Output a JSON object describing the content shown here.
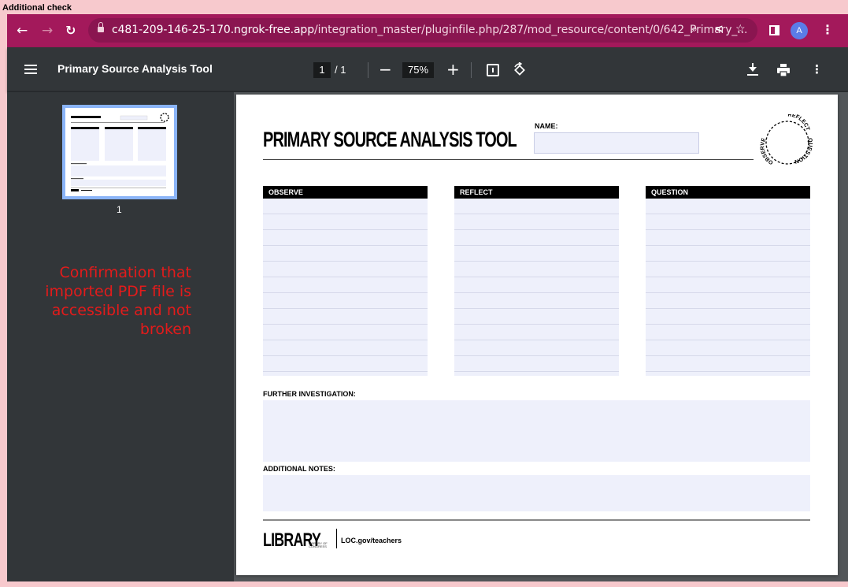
{
  "page_label": "Additional check",
  "browser": {
    "url_host": "c481-209-146-25-170.ngrok-free.app",
    "url_path": "/integration_master/pluginfile.php/287/mod_resource/content/0/642_Primary_...",
    "avatar_letter": "A"
  },
  "pdf_viewer": {
    "title": "Primary Source Analysis Tool",
    "current_page": "1",
    "total_pages": "/ 1",
    "zoom": "75%",
    "thumbnail_label": "1"
  },
  "annotation": "Confirmation that imported PDF file is accessible and not broken",
  "document": {
    "title": "PRIMARY SOURCE ANALYSIS TOOL",
    "name_label": "NAME:",
    "seal_words": [
      "REFLECT",
      "QUESTION",
      "OBSERVE"
    ],
    "columns": [
      "OBSERVE",
      "REFLECT",
      "QUESTION"
    ],
    "further_label": "FURTHER INVESTIGATION:",
    "notes_label": "ADDITIONAL NOTES:",
    "logo_text": "LIBRARY",
    "logo_small": "LIBRARY OF CONGRESS",
    "footer_url": "LOC.gov/teachers"
  },
  "colors": {
    "browser_frame": "#a3195b",
    "viewer_bg": "#323639",
    "annotation": "#e31b1b",
    "field_fill": "#eef0fb"
  }
}
